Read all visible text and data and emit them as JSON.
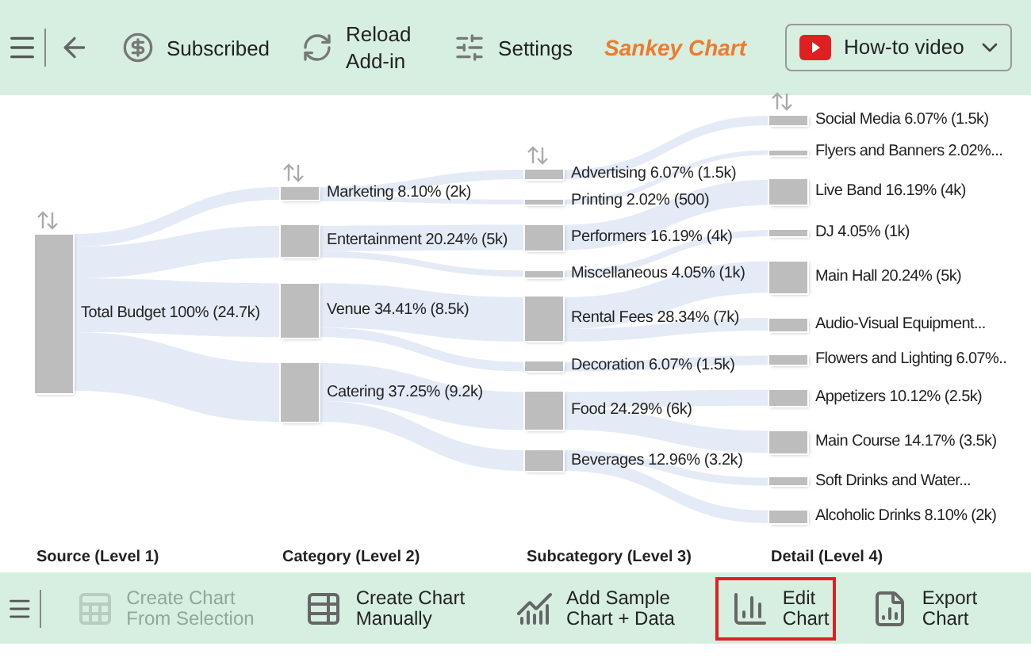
{
  "top_toolbar": {
    "items": [
      {
        "kind": "subscribed",
        "label": "Subscribed"
      },
      {
        "kind": "reload",
        "label": "Reload Add-in"
      },
      {
        "kind": "settings",
        "label": "Settings"
      }
    ],
    "title": "Sankey Chart",
    "video_dropdown": {
      "label": "How-to video"
    }
  },
  "chart": {
    "column_headings": [
      "Source (Level 1)",
      "Category (Level 2)",
      "Subcategory (Level 3)",
      "Detail (Level 4)"
    ],
    "root": {
      "label": "Total Budget 100% (24.7k)",
      "children": [
        {
          "label": "Marketing 8.10% (2k)",
          "children": [
            {
              "label": "Advertising 6.07% (1.5k)",
              "children": [
                {
                  "label": "Social Media 6.07% (1.5k)"
                }
              ]
            },
            {
              "label": "Printing 2.02% (500)",
              "children": [
                {
                  "label": "Flyers and Banners 2.02%..."
                }
              ]
            }
          ]
        },
        {
          "label": "Entertainment 20.24% (5k)",
          "children": [
            {
              "label": "Performers 16.19% (4k)",
              "children": [
                {
                  "label": "Live Band 16.19% (4k)"
                }
              ]
            },
            {
              "label": "Miscellaneous 4.05% (1k)",
              "children": [
                {
                  "label": "DJ 4.05% (1k)"
                }
              ]
            }
          ]
        },
        {
          "label": "Venue 34.41% (8.5k)",
          "children": [
            {
              "label": "Rental Fees 28.34% (7k)",
              "children": [
                {
                  "label": "Main Hall 20.24% (5k)"
                },
                {
                  "label": "Audio-Visual Equipment..."
                }
              ]
            },
            {
              "label": "Decoration 6.07% (1.5k)",
              "children": [
                {
                  "label": "Flowers and Lighting 6.07%.."
                }
              ]
            }
          ]
        },
        {
          "label": "Catering 37.25% (9.2k)",
          "children": [
            {
              "label": "Food 24.29% (6k)",
              "children": [
                {
                  "label": "Appetizers 10.12% (2.5k)"
                },
                {
                  "label": "Main Course 14.17% (3.5k)"
                }
              ]
            },
            {
              "label": "Beverages 12.96% (3.2k)",
              "children": [
                {
                  "label": "Soft Drinks and Water..."
                },
                {
                  "label": "Alcoholic Drinks 8.10% (2k)"
                }
              ]
            }
          ]
        }
      ]
    }
  },
  "bottom_toolbar": {
    "buttons": [
      {
        "kind": "from-selection",
        "lines": [
          "Create Chart",
          "From Selection"
        ],
        "disabled": true,
        "highlighted": false
      },
      {
        "kind": "manual",
        "lines": [
          "Create Chart",
          "Manually"
        ],
        "disabled": false,
        "highlighted": false
      },
      {
        "kind": "sample",
        "lines": [
          "Add Sample",
          "Chart + Data"
        ],
        "disabled": false,
        "highlighted": false
      },
      {
        "kind": "edit",
        "lines": [
          "Edit",
          "Chart"
        ],
        "disabled": false,
        "highlighted": true
      },
      {
        "kind": "export",
        "lines": [
          "Export",
          "Chart"
        ],
        "disabled": false,
        "highlighted": false
      }
    ]
  }
}
